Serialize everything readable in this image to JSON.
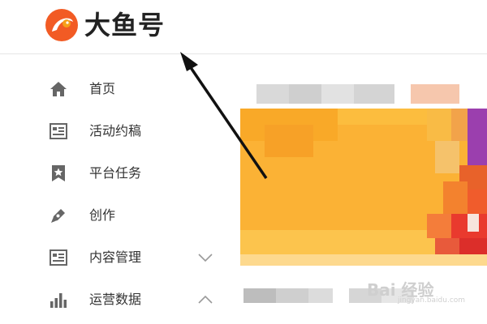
{
  "header": {
    "brand": "大鱼号",
    "logo_icon": "dayu-fish-logo",
    "accent": "#f25b24"
  },
  "sidebar": {
    "items": [
      {
        "label": "首页",
        "icon": "home-icon"
      },
      {
        "label": "活动约稿",
        "icon": "newspaper-icon"
      },
      {
        "label": "平台任务",
        "icon": "star-bookmark-icon"
      },
      {
        "label": "创作",
        "icon": "pen-icon"
      },
      {
        "label": "内容管理",
        "icon": "document-icon",
        "expand": "chevron-down-icon"
      },
      {
        "label": "运营数据",
        "icon": "bar-chart-icon",
        "expand": "chevron-up-icon"
      }
    ],
    "icon_color": "#666666"
  },
  "annotation": {
    "arrow_color": "#111111"
  },
  "watermark": {
    "text": "Bai 经验",
    "sub": "jingyan.baidu.com"
  }
}
